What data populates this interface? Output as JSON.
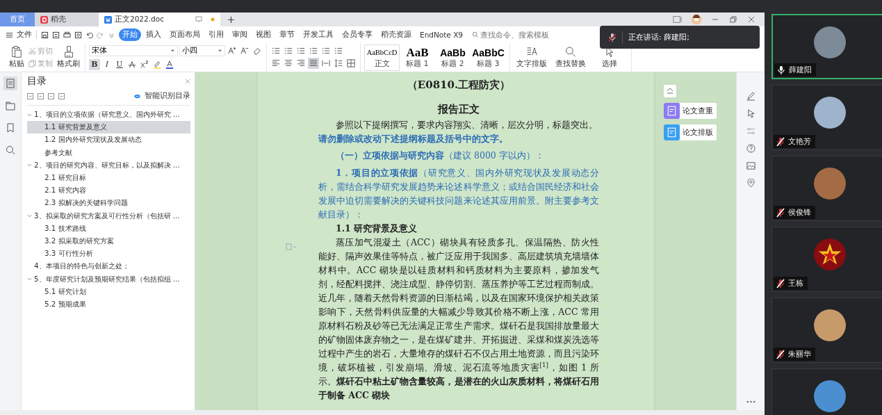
{
  "app_tabs": [
    {
      "label": "首页",
      "kind": "home",
      "selected": false
    },
    {
      "label": "稻壳",
      "kind": "docer",
      "selected": false
    },
    {
      "label": "正文2022.doc",
      "kind": "doc",
      "selected": true
    }
  ],
  "menu": {
    "file": "文件",
    "tabs": [
      {
        "label": "开始",
        "selected": true
      },
      {
        "label": "插入",
        "selected": false
      },
      {
        "label": "页面布局",
        "selected": false
      },
      {
        "label": "引用",
        "selected": false
      },
      {
        "label": "审阅",
        "selected": false
      },
      {
        "label": "视图",
        "selected": false
      },
      {
        "label": "章节",
        "selected": false
      },
      {
        "label": "开发工具",
        "selected": false
      },
      {
        "label": "会员专享",
        "selected": false
      },
      {
        "label": "稻壳资源",
        "selected": false
      },
      {
        "label": "EndNote X9",
        "selected": false
      }
    ],
    "search": {
      "placeholder": "查找命令、搜索模板"
    }
  },
  "ribbon": {
    "paste": "粘贴",
    "cut": "剪切",
    "copy": "复制",
    "format_painter": "格式刷",
    "font": {
      "name": "宋体",
      "size": "小四"
    },
    "format": [
      {
        "label": "B",
        "kind": "bold",
        "on": true
      },
      {
        "label": "I",
        "kind": "italic",
        "on": false
      },
      {
        "label": "U",
        "kind": "underline",
        "on": false
      }
    ],
    "alignment": [
      {
        "kind": "left",
        "selected": false
      },
      {
        "kind": "center",
        "selected": false
      },
      {
        "kind": "right",
        "selected": false
      },
      {
        "kind": "justify",
        "selected": true
      },
      {
        "kind": "distributed",
        "selected": false
      }
    ],
    "styles": [
      {
        "preview": "AaBbCcD",
        "label": "正文",
        "kind": "body"
      },
      {
        "preview": "AaB",
        "label": "标题 1",
        "kind": "h1"
      },
      {
        "preview": "AaBb",
        "label": "标题 2",
        "kind": "h2"
      },
      {
        "preview": "AaBbC",
        "label": "标题 3",
        "kind": "h3"
      }
    ],
    "tools": [
      {
        "label": "文字排版",
        "kind": "layout"
      },
      {
        "label": "查找替换",
        "kind": "find"
      },
      {
        "label": "选择",
        "kind": "select"
      }
    ]
  },
  "toc": {
    "title": "目录",
    "smart": "智能识别目录",
    "items": [
      {
        "label": "1、项目的立项依据（研究意义、国内外研究 ...",
        "expanded": true,
        "selected": false,
        "children": [
          {
            "label": "1.1 研究背景及意义",
            "selected": true
          },
          {
            "label": "1.2 国内外研究现状及发展动态",
            "selected": false
          },
          {
            "label": "参考文献",
            "selected": false
          }
        ]
      },
      {
        "label": "2、项目的研究内容、研究目标，以及拟解决 ...",
        "expanded": true,
        "selected": false,
        "children": [
          {
            "label": "2.1 研究目标",
            "selected": false
          },
          {
            "label": "2.1  研究内容",
            "selected": false
          },
          {
            "label": "2.3 拟解决的关键科学问题",
            "selected": false
          }
        ]
      },
      {
        "label": "3、拟采取的研究方案及可行性分析（包括研 ...",
        "expanded": true,
        "selected": false,
        "children": [
          {
            "label": "3.1  技术路线",
            "selected": false
          },
          {
            "label": "3.2  拟采取的研究方案",
            "selected": false
          },
          {
            "label": "3.3  可行性分析",
            "selected": false
          }
        ]
      },
      {
        "label": "4、本项目的特色与创新之处；",
        "selected": false
      },
      {
        "label": "5、年度研究计划及预期研究结果（包括拟组 ...",
        "expanded": true,
        "selected": false,
        "children": [
          {
            "label": "5.1  研究计划",
            "selected": false
          },
          {
            "label": "5.2  预期成果",
            "selected": false
          }
        ]
      }
    ]
  },
  "document": [
    {
      "kind": "subtitle",
      "text": "（E0810.工程防灾）"
    },
    {
      "kind": "title",
      "text": "报告正文"
    },
    {
      "kind": "para",
      "text": "参照以下提纲撰写，要求内容翔实、清晰，层次分明，标题突出。"
    },
    {
      "kind": "note",
      "text": "请勿删除或改动下述提纲标题及括号中的文字。"
    },
    {
      "kind": "section",
      "text": "**（一）立项依据与研究内容**（建议 8000 字以内）："
    },
    {
      "kind": "guide",
      "text": "**1．项目的立项依据**（研究意义、国内外研究现状及发展动态分析，需结合科学研究发展趋势来论述科学意义；或结合国民经济和社会发展中迫切需要解决的关键科技问题来论述其应用前景。附主要参考文献目录）："
    },
    {
      "kind": "heading",
      "text": "1.1 研究背景及意义"
    },
    {
      "kind": "para",
      "text": "蒸压加气混凝土（ACC）砌块具有轻质多孔、保温隔热、防火性能好、隔声效果佳等特点，被广泛应用于我国多、高层建筑填充墙墙体材料中。ACC 砌块是以硅质材料和钙质材料为主要原料，掺加发气剂，经配料搅拌、浇注成型、静停切割、蒸压养护等工艺过程而制成。近几年，随着天然骨料资源的日渐枯竭，以及在国家环境保护相关政策影响下，天然骨料供应量的大幅减少导致其价格不断上涨，ACC 常用原材料石粉及砂等已无法满足正常生产需求。煤矸石是我国排放量最大的矿物固体废弃物之一，是在煤矿建井、开拓掘进、采煤和煤炭洗选等过程中产生的岩石，大量堆存的煤矸石不仅占用土地资源，而且污染环境，破坏植被，引发崩塌、滑坡、泥石流等地质灾害$^{[1]}$，如图 1 所示。**煤矸石中粘土矿物含量较高，是潜在的火山灰质材料，将煤矸石用于制备 ACC 砌块**"
    }
  ],
  "side_buttons": [
    {
      "label": "论文查重",
      "kind": "check"
    },
    {
      "label": "论文排版",
      "kind": "format"
    }
  ],
  "meeting": {
    "speaking": "正在讲话: 薛建阳;",
    "participants": [
      {
        "name": "薛建阳",
        "muted": false,
        "speaking": true,
        "kind": "photo"
      },
      {
        "name": "文艳芳",
        "muted": true,
        "speaking": false,
        "kind": "photo"
      },
      {
        "name": "侯俊锋",
        "muted": true,
        "speaking": false,
        "kind": "photo"
      },
      {
        "name": "王栋",
        "muted": true,
        "speaking": false,
        "kind": "emblem"
      },
      {
        "name": "朱丽华",
        "muted": true,
        "speaking": false,
        "kind": "photo"
      },
      {
        "speaking": false,
        "kind": "photo"
      }
    ]
  }
}
